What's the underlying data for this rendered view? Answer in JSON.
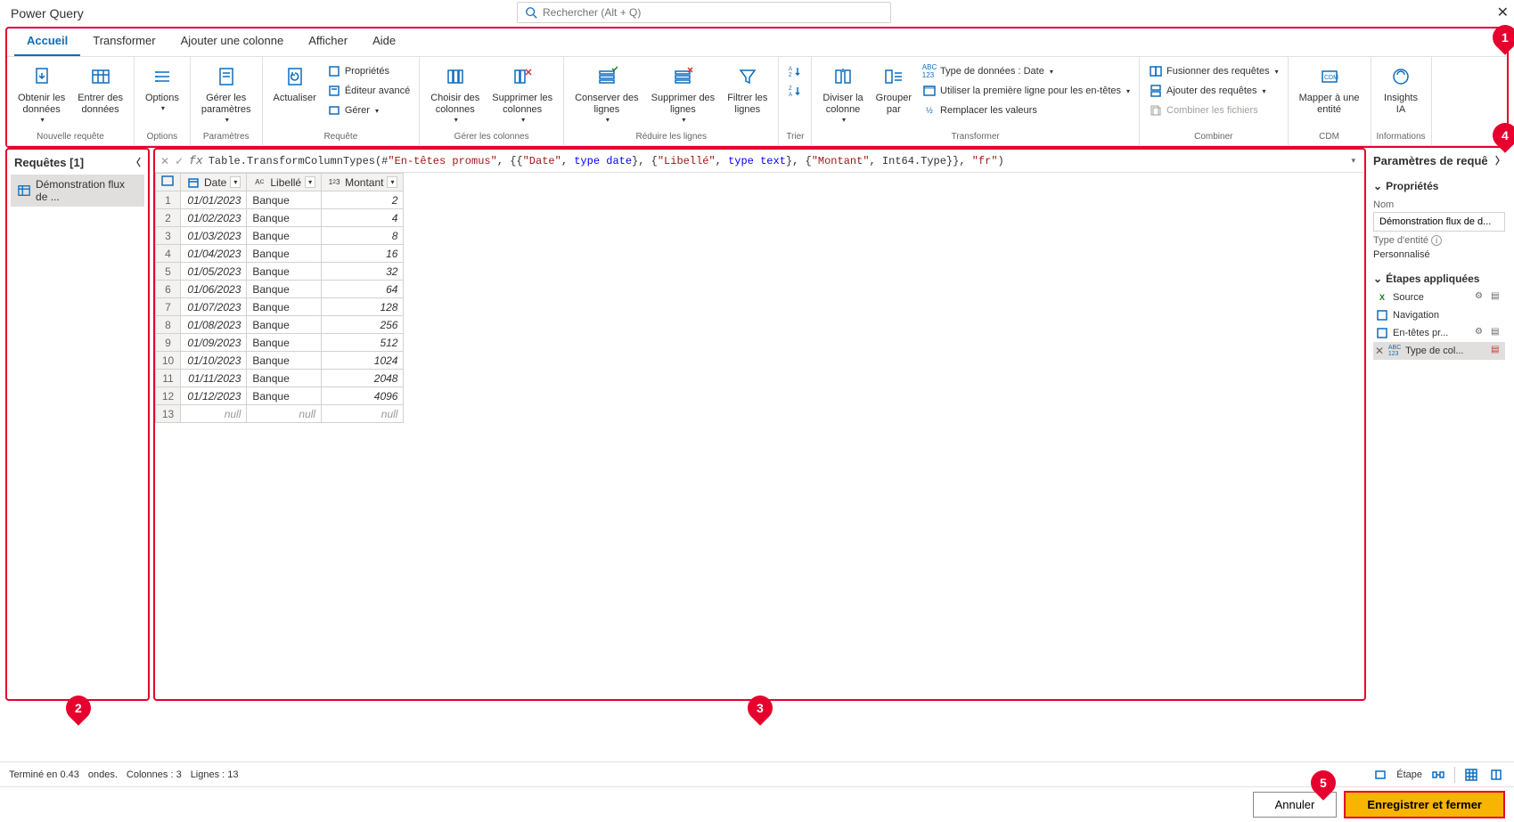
{
  "app_title": "Power Query",
  "search_placeholder": "Rechercher (Alt + Q)",
  "tabs": [
    "Accueil",
    "Transformer",
    "Ajouter une colonne",
    "Afficher",
    "Aide"
  ],
  "ribbon": {
    "groups": {
      "nouvelle_requete": {
        "label": "Nouvelle requête",
        "obtenir": "Obtenir les\ndonnées",
        "entrer": "Entrer des\ndonnées"
      },
      "options": {
        "label": "Options",
        "btn": "Options"
      },
      "parametres": {
        "label": "Paramètres",
        "btn": "Gérer les\nparamètres"
      },
      "requete": {
        "label": "Requête",
        "actualiser": "Actualiser",
        "proprietes": "Propriétés",
        "editeur": "Éditeur avancé",
        "gerer": "Gérer"
      },
      "gerer_colonnes": {
        "label": "Gérer les colonnes",
        "choisir": "Choisir des\ncolonnes",
        "supprimer": "Supprimer les\ncolonnes"
      },
      "reduire_lignes": {
        "label": "Réduire les lignes",
        "conserver": "Conserver des\nlignes",
        "supprimer": "Supprimer des\nlignes",
        "filtrer": "Filtrer les\nlignes"
      },
      "trier": {
        "label": "Trier"
      },
      "transformer": {
        "label": "Transformer",
        "diviser": "Diviser la\ncolonne",
        "grouper": "Grouper\npar",
        "type_donnees": "Type de données : Date",
        "premiere_ligne": "Utiliser la première ligne pour les en-têtes",
        "remplacer": "Remplacer les valeurs"
      },
      "combiner": {
        "label": "Combiner",
        "fusionner": "Fusionner des requêtes",
        "ajouter": "Ajouter des requêtes",
        "fichiers": "Combiner les fichiers"
      },
      "cdm": {
        "label": "CDM",
        "mapper": "Mapper à une\nentité"
      },
      "informations": {
        "label": "Informations",
        "insights": "Insights\nIA"
      }
    }
  },
  "queries_panel": {
    "title": "Requêtes [1]",
    "item": "Démonstration flux de ..."
  },
  "formula": {
    "prefix": "Table.TransformColumnTypes(#",
    "p1": "\"En-têtes promus\"",
    "p2": ", {{",
    "p3": "\"Date\"",
    "p4": ", ",
    "p5": "type date",
    "p6": "}, {",
    "p7": "\"Libellé\"",
    "p8": ", ",
    "p9": "type text",
    "p10": "}, {",
    "p11": "\"Montant\"",
    "p12": ", Int64.Type}}, ",
    "p13": "\"fr\"",
    "p14": ")"
  },
  "columns": {
    "date": "Date",
    "libelle": "Libellé",
    "montant": "Montant"
  },
  "rows": [
    {
      "n": "1",
      "date": "01/01/2023",
      "lib": "Banque",
      "mont": "2"
    },
    {
      "n": "2",
      "date": "01/02/2023",
      "lib": "Banque",
      "mont": "4"
    },
    {
      "n": "3",
      "date": "01/03/2023",
      "lib": "Banque",
      "mont": "8"
    },
    {
      "n": "4",
      "date": "01/04/2023",
      "lib": "Banque",
      "mont": "16"
    },
    {
      "n": "5",
      "date": "01/05/2023",
      "lib": "Banque",
      "mont": "32"
    },
    {
      "n": "6",
      "date": "01/06/2023",
      "lib": "Banque",
      "mont": "64"
    },
    {
      "n": "7",
      "date": "01/07/2023",
      "lib": "Banque",
      "mont": "128"
    },
    {
      "n": "8",
      "date": "01/08/2023",
      "lib": "Banque",
      "mont": "256"
    },
    {
      "n": "9",
      "date": "01/09/2023",
      "lib": "Banque",
      "mont": "512"
    },
    {
      "n": "10",
      "date": "01/10/2023",
      "lib": "Banque",
      "mont": "1024"
    },
    {
      "n": "11",
      "date": "01/11/2023",
      "lib": "Banque",
      "mont": "2048"
    },
    {
      "n": "12",
      "date": "01/12/2023",
      "lib": "Banque",
      "mont": "4096"
    },
    {
      "n": "13",
      "date": "null",
      "lib": "null",
      "mont": "null"
    }
  ],
  "settings": {
    "title": "Paramètres de requê",
    "props": "Propriétés",
    "nom_label": "Nom",
    "nom_value": "Démonstration flux de d...",
    "type_entite": "Type d'entité",
    "personnalise": "Personnalisé",
    "etapes": "Étapes appliquées",
    "steps": [
      "Source",
      "Navigation",
      "En-têtes pr...",
      "Type de col..."
    ]
  },
  "status": {
    "termine": "Terminé en 0.43",
    "ondes": "ondes.",
    "colonnes": "Colonnes : 3",
    "lignes": "Lignes : 13",
    "etape": "Étape"
  },
  "footer": {
    "annuler": "Annuler",
    "enregistrer": "Enregistrer et fermer"
  },
  "callouts": {
    "1": "1",
    "2": "2",
    "3": "3",
    "4": "4",
    "5": "5"
  }
}
